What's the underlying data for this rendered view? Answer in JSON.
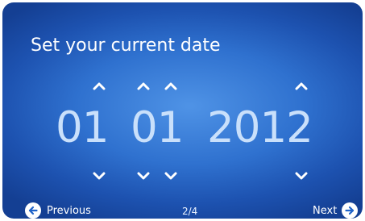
{
  "title": "Set your current date",
  "date": {
    "day": "01",
    "month": "01",
    "year": "2012"
  },
  "navigation": {
    "previous_label": "Previous",
    "next_label": "Next",
    "page_indicator": "2/4"
  },
  "colors": {
    "background_center": "#4f93e6",
    "background_edge": "#143f93",
    "digit_color": "#c9e0fb",
    "icon_arrow": "#1f63c9"
  },
  "icons": {
    "increment": "chevron-up-icon",
    "decrement": "chevron-down-icon",
    "previous": "arrow-left-circle-icon",
    "next": "arrow-right-circle-icon"
  }
}
